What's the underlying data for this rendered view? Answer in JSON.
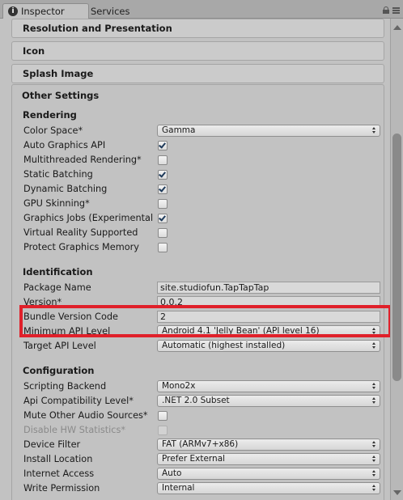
{
  "tabs": {
    "inspector": "Inspector",
    "services": "Services"
  },
  "foldouts": {
    "resolution": "Resolution and Presentation",
    "icon": "Icon",
    "splash": "Splash Image",
    "other": "Other Settings"
  },
  "rendering": {
    "title": "Rendering",
    "color_space_label": "Color Space*",
    "color_space_value": "Gamma",
    "auto_graphics_api": {
      "label": "Auto Graphics API",
      "checked": true
    },
    "multithreaded_rendering": {
      "label": "Multithreaded Rendering*",
      "checked": false
    },
    "static_batching": {
      "label": "Static Batching",
      "checked": true
    },
    "dynamic_batching": {
      "label": "Dynamic Batching",
      "checked": true
    },
    "gpu_skinning": {
      "label": "GPU Skinning*",
      "checked": false
    },
    "graphics_jobs": {
      "label": "Graphics Jobs (Experimental",
      "checked": true
    },
    "virtual_reality": {
      "label": "Virtual Reality Supported",
      "checked": false
    },
    "protect_graphics_memory": {
      "label": "Protect Graphics Memory",
      "checked": false
    }
  },
  "identification": {
    "title": "Identification",
    "package_name_label": "Package Name",
    "package_name_value": "site.studiofun.TapTapTap",
    "version_label": "Version*",
    "version_value": "0.0.2",
    "bundle_version_code_label": "Bundle Version Code",
    "bundle_version_code_value": "2",
    "min_api_label": "Minimum API Level",
    "min_api_value": "Android 4.1 'Jelly Bean' (API level 16)",
    "target_api_label": "Target API Level",
    "target_api_value": "Automatic (highest installed)"
  },
  "configuration": {
    "title": "Configuration",
    "scripting_backend_label": "Scripting Backend",
    "scripting_backend_value": "Mono2x",
    "api_compat_label": "Api Compatibility Level*",
    "api_compat_value": ".NET 2.0 Subset",
    "mute_audio": {
      "label": "Mute Other Audio Sources*",
      "checked": false
    },
    "disable_hw_stats": {
      "label": "Disable HW Statistics*",
      "checked": false
    },
    "device_filter_label": "Device Filter",
    "device_filter_value": "FAT (ARMv7+x86)",
    "install_location_label": "Install Location",
    "install_location_value": "Prefer External",
    "internet_access_label": "Internet Access",
    "internet_access_value": "Auto",
    "write_permission_label": "Write Permission",
    "write_permission_value": "Internal"
  },
  "colors": {
    "highlight": "#e0202a",
    "panel_bg": "#c2c2c2"
  }
}
